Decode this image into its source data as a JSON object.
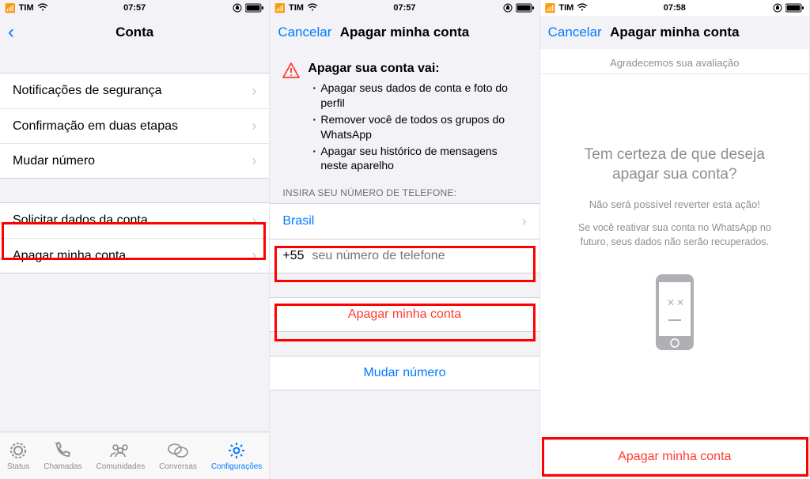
{
  "status": {
    "carrier": "TIM"
  },
  "screen1": {
    "time": "07:57",
    "title": "Conta",
    "group1": [
      {
        "label": "Notificações de segurança"
      },
      {
        "label": "Confirmação em duas etapas"
      },
      {
        "label": "Mudar número"
      }
    ],
    "group2": [
      {
        "label": "Solicitar dados da conta"
      },
      {
        "label": "Apagar minha conta"
      }
    ],
    "tabs": {
      "status": "Status",
      "calls": "Chamadas",
      "communities": "Comunidades",
      "chats": "Conversas",
      "settings": "Configurações"
    }
  },
  "screen2": {
    "time": "07:57",
    "cancel": "Cancelar",
    "title": "Apagar minha conta",
    "warn_title": "Apagar sua conta vai:",
    "warn_items": [
      "Apagar seus dados de conta e foto do perfil",
      "Remover você de todos os grupos do WhatsApp",
      "Apagar seu histórico de mensagens neste aparelho"
    ],
    "section_header": "INSIRA SEU NÚMERO DE TELEFONE:",
    "country": "Brasil",
    "prefix": "+55",
    "placeholder": "seu número de telefone",
    "delete_btn": "Apagar minha conta",
    "change_btn": "Mudar número"
  },
  "screen3": {
    "time": "07:58",
    "cancel": "Cancelar",
    "title": "Apagar minha conta",
    "thanks": "Agradecemos sua avaliação",
    "question": "Tem certeza de que deseja apagar sua conta?",
    "warn1": "Não será possível reverter esta ação!",
    "warn2": "Se você reativar sua conta no WhatsApp no futuro, seus dados não serão recuperados.",
    "delete_btn": "Apagar minha conta"
  }
}
